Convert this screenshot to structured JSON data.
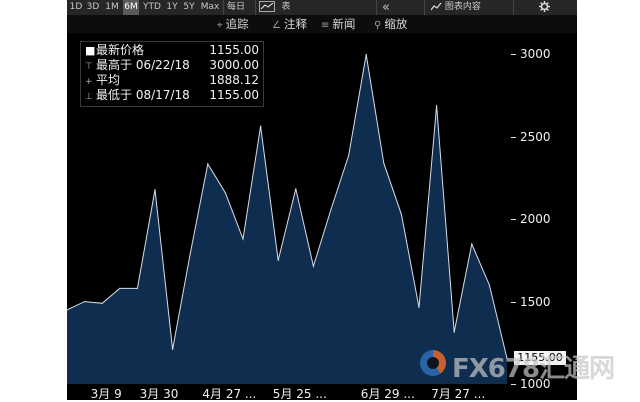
{
  "toolbar": {
    "periods": [
      "1D",
      "3D",
      "1M",
      "6M",
      "YTD",
      "1Y",
      "5Y",
      "Max"
    ],
    "selected_period": "6M",
    "frequency": "每日",
    "frequency_arrow": "▼",
    "chart_type_label": "表",
    "collapse_label": "«",
    "chart_content_label": "图表内容",
    "settings_icon": "gear-icon"
  },
  "toolbar2": {
    "track_label": "追踪",
    "annotate_label": "注释",
    "news_label": "新闻",
    "zoom_label": "缩放"
  },
  "legend": {
    "rows": [
      {
        "label": "最新价格",
        "value": "1155.00"
      },
      {
        "label": "最高于 06/22/18",
        "value": "3000.00"
      },
      {
        "label": "平均",
        "value": "1888.12"
      },
      {
        "label": "最低于 08/17/18",
        "value": "1155.00"
      }
    ]
  },
  "last_price_box": "1155.00",
  "watermark": "FX678汇通网",
  "colors": {
    "background": "#000000",
    "area_fill": "#0f2d4f",
    "line": "#d8dde6",
    "toolbar": "#262626"
  },
  "chart_data": {
    "type": "area",
    "x": [
      "2018-02-23",
      "2018-03-02",
      "2018-03-09",
      "2018-03-16",
      "2018-03-23",
      "2018-03-30",
      "2018-04-06",
      "2018-04-13",
      "2018-04-20",
      "2018-04-27",
      "2018-05-04",
      "2018-05-11",
      "2018-05-18",
      "2018-05-25",
      "2018-06-01",
      "2018-06-08",
      "2018-06-15",
      "2018-06-22",
      "2018-06-29",
      "2018-07-06",
      "2018-07-13",
      "2018-07-20",
      "2018-07-27",
      "2018-08-03",
      "2018-08-10",
      "2018-08-17"
    ],
    "values": [
      1450,
      1500,
      1490,
      1580,
      1580,
      2180,
      1210,
      1790,
      2335,
      2160,
      1880,
      2565,
      1750,
      2185,
      1715,
      2060,
      2385,
      3000,
      2340,
      2030,
      1465,
      2690,
      1315,
      1850,
      1600,
      1155
    ],
    "x_tick_labels": [
      "3月 9",
      "3月 30",
      "4月 27 ...",
      "5月 25 ...",
      "6月 29 ...",
      "7月 27 ..."
    ],
    "y_ticks": [
      1000,
      1500,
      2000,
      2500,
      3000
    ],
    "ylim": [
      1000,
      3100
    ],
    "title": "",
    "xlabel": "",
    "ylabel": "",
    "grid": false
  }
}
